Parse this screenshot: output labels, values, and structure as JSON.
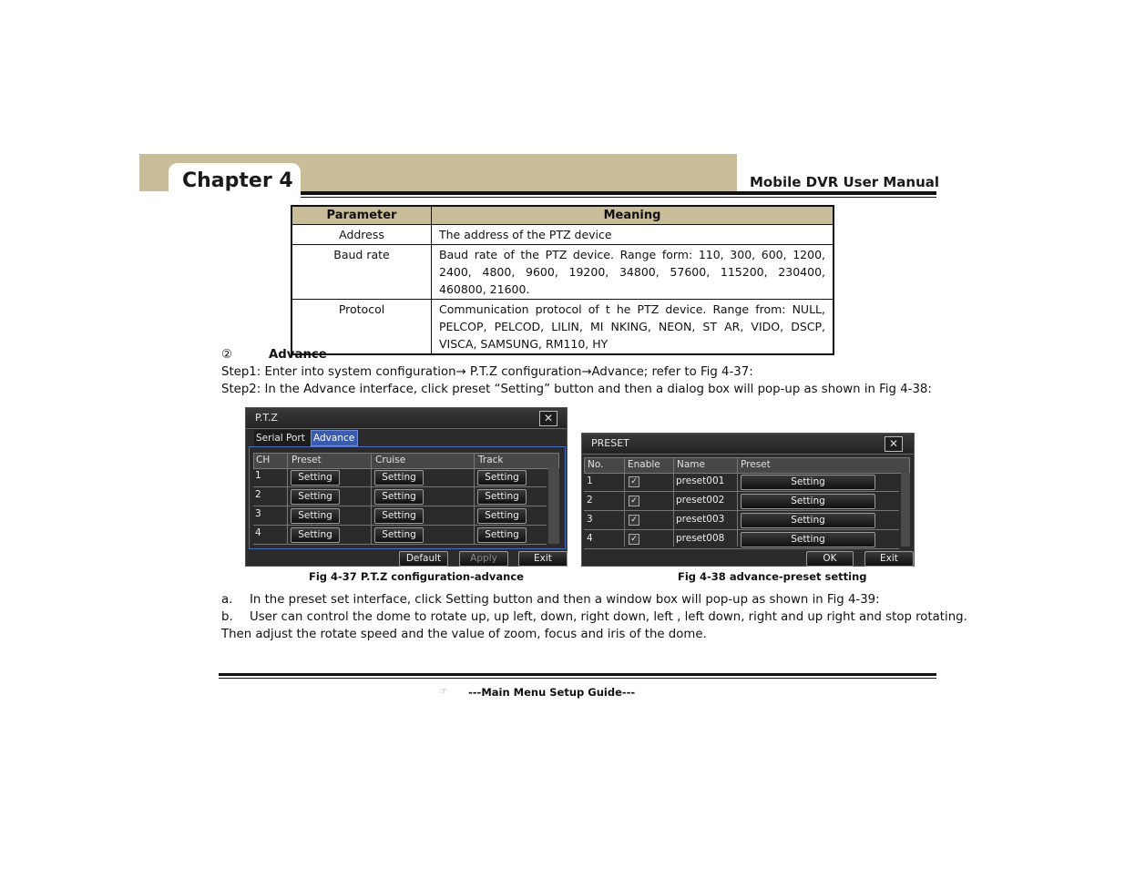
{
  "header": {
    "chapter": "Chapter 4",
    "manual_title": "Mobile DVR User Manual",
    "accent_color": "#c8bd98"
  },
  "param_table": {
    "headers": [
      "Parameter",
      "Meaning"
    ],
    "rows": [
      {
        "parameter": "Address",
        "meaning": "The address of the PTZ device"
      },
      {
        "parameter": "Baud rate",
        "meaning": "Baud rate of the PTZ device. Range form: 110, 300, 600, 1200, 2400, 4800, 9600, 19200, 34800, 57600, 115200, 230400, 460800, 21600."
      },
      {
        "parameter": "Protocol",
        "meaning": "Communication protocol of t he PTZ device. Range from: NULL, PELCOP, PELCOD, LILIN, MI NKING, NEON, ST AR, VIDO, DSCP, VISCA, SAMSUNG, RM110, HY"
      }
    ]
  },
  "section": {
    "marker": "②",
    "title": "Advance",
    "step1": "Step1: Enter into system configuration→ P.T.Z configuration→Advance; refer to Fig 4-37:",
    "step2": "Step2: In the Advance interface, click preset “Setting” button and then a dialog box will pop-up as shown in Fig 4-38:"
  },
  "ptz_dialog": {
    "title": "P.T.Z",
    "close_icon": "close-icon",
    "tabs": [
      "Serial Port",
      "Advance"
    ],
    "active_tab": "Advance",
    "columns": [
      "CH",
      "Preset",
      "Cruise",
      "Track"
    ],
    "rows": [
      {
        "ch": "1",
        "preset": "Setting",
        "cruise": "Setting",
        "track": "Setting"
      },
      {
        "ch": "2",
        "preset": "Setting",
        "cruise": "Setting",
        "track": "Setting"
      },
      {
        "ch": "3",
        "preset": "Setting",
        "cruise": "Setting",
        "track": "Setting"
      },
      {
        "ch": "4",
        "preset": "Setting",
        "cruise": "Setting",
        "track": "Setting"
      }
    ],
    "buttons": {
      "default": "Default",
      "apply": "Apply",
      "exit": "Exit"
    }
  },
  "preset_dialog": {
    "title": "PRESET",
    "close_icon": "close-icon",
    "columns": [
      "No.",
      "Enable",
      "Name",
      "Preset"
    ],
    "rows": [
      {
        "no": "1",
        "enabled": true,
        "name": "preset001",
        "preset": "Setting"
      },
      {
        "no": "2",
        "enabled": true,
        "name": "preset002",
        "preset": "Setting"
      },
      {
        "no": "3",
        "enabled": true,
        "name": "preset003",
        "preset": "Setting"
      },
      {
        "no": "4",
        "enabled": true,
        "name": "preset008",
        "preset": "Setting"
      }
    ],
    "buttons": {
      "ok": "OK",
      "exit": "Exit"
    }
  },
  "captions": {
    "fig37": "Fig 4-37 P.T.Z configuration-advance",
    "fig38": "Fig 4-38 advance-preset setting"
  },
  "notes": {
    "a_label": "a.",
    "a_text": "In the preset set interface, click Setting button and then a window box will pop-up as shown in Fig 4-39:",
    "b_label": "b.",
    "b_text": "User can control the dome to rotate up, up left, down, right down, left , left down, right and up right and stop rotating.",
    "b_cont": "Then adjust the rotate speed and the value of zoom, focus and iris of the dome."
  },
  "footer": {
    "icon": "pointing-hand-icon",
    "icon_glyph": "☞",
    "text": "---Main Menu Setup Guide---"
  }
}
